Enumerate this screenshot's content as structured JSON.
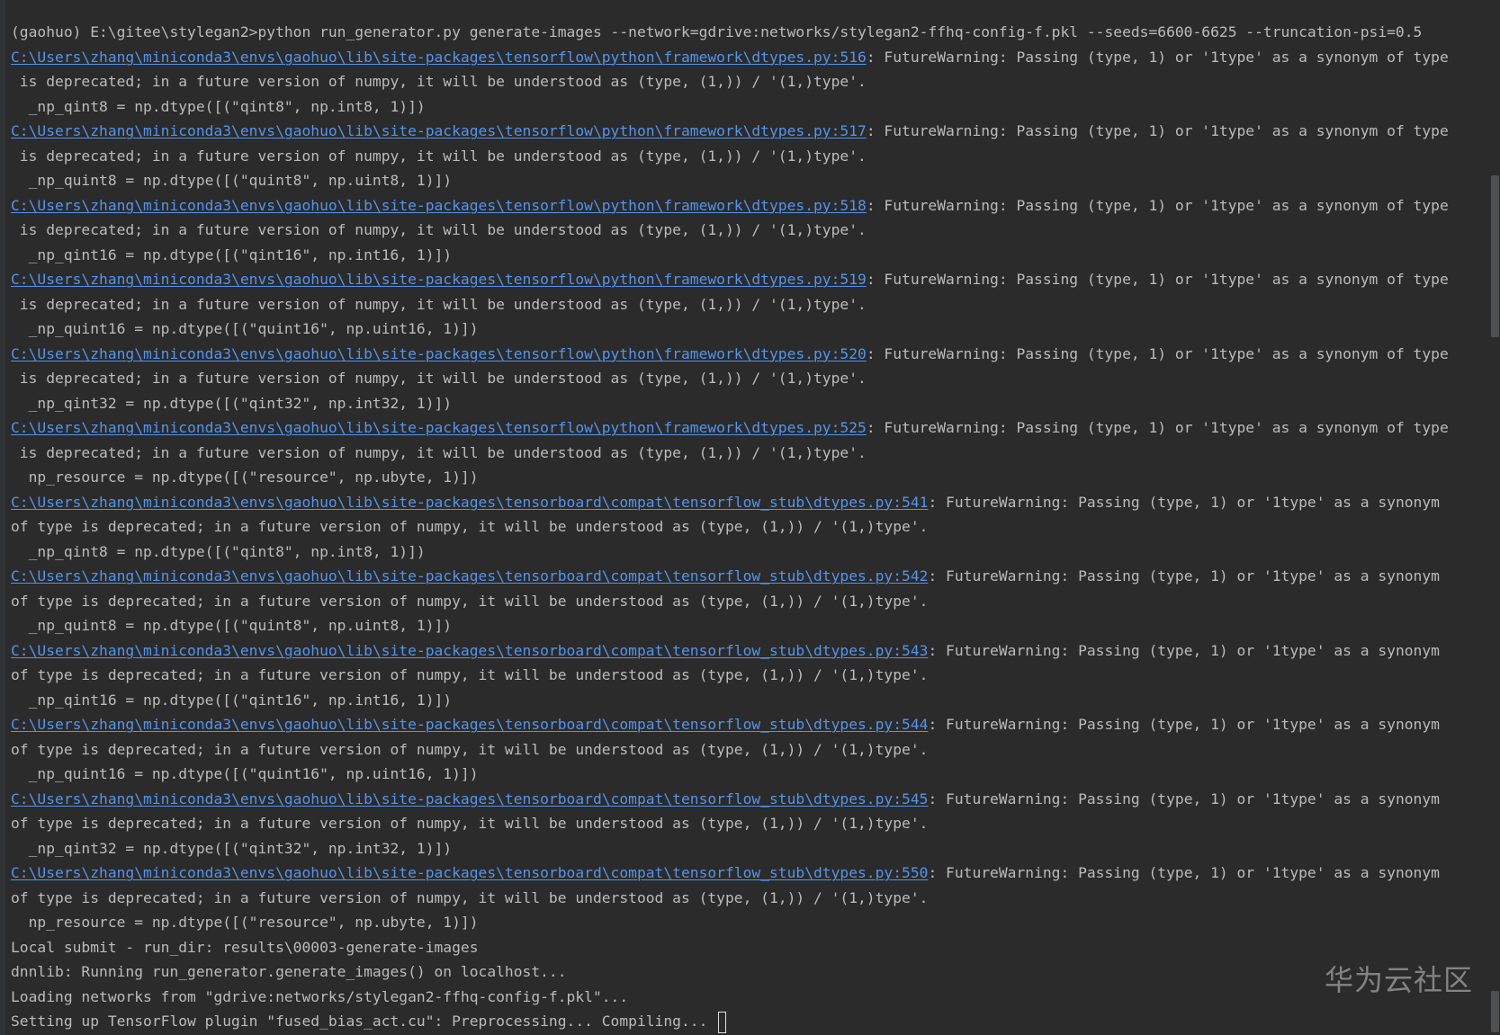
{
  "terminal": {
    "prompt_line": "(gaohuo) E:\\gitee\\stylegan2>python run_generator.py generate-images --network=gdrive:networks/stylegan2-ffhq-config-f.pkl --seeds=6600-6625 --truncation-psi=0.5",
    "warnings": [
      {
        "link": "C:\\Users\\zhang\\miniconda3\\envs\\gaohuo\\lib\\site-packages\\tensorflow\\python\\framework\\dtypes.py:516",
        "msg1": ": FutureWarning: Passing (type, 1) or '1type' as a synonym of type",
        "msg2": " is deprecated; in a future version of numpy, it will be understood as (type, (1,)) / '(1,)type'.",
        "code": "  _np_qint8 = np.dtype([(\"qint8\", np.int8, 1)])"
      },
      {
        "link": "C:\\Users\\zhang\\miniconda3\\envs\\gaohuo\\lib\\site-packages\\tensorflow\\python\\framework\\dtypes.py:517",
        "msg1": ": FutureWarning: Passing (type, 1) or '1type' as a synonym of type",
        "msg2": " is deprecated; in a future version of numpy, it will be understood as (type, (1,)) / '(1,)type'.",
        "code": "  _np_quint8 = np.dtype([(\"quint8\", np.uint8, 1)])"
      },
      {
        "link": "C:\\Users\\zhang\\miniconda3\\envs\\gaohuo\\lib\\site-packages\\tensorflow\\python\\framework\\dtypes.py:518",
        "msg1": ": FutureWarning: Passing (type, 1) or '1type' as a synonym of type",
        "msg2": " is deprecated; in a future version of numpy, it will be understood as (type, (1,)) / '(1,)type'.",
        "code": "  _np_qint16 = np.dtype([(\"qint16\", np.int16, 1)])"
      },
      {
        "link": "C:\\Users\\zhang\\miniconda3\\envs\\gaohuo\\lib\\site-packages\\tensorflow\\python\\framework\\dtypes.py:519",
        "msg1": ": FutureWarning: Passing (type, 1) or '1type' as a synonym of type",
        "msg2": " is deprecated; in a future version of numpy, it will be understood as (type, (1,)) / '(1,)type'.",
        "code": "  _np_quint16 = np.dtype([(\"quint16\", np.uint16, 1)])"
      },
      {
        "link": "C:\\Users\\zhang\\miniconda3\\envs\\gaohuo\\lib\\site-packages\\tensorflow\\python\\framework\\dtypes.py:520",
        "msg1": ": FutureWarning: Passing (type, 1) or '1type' as a synonym of type",
        "msg2": " is deprecated; in a future version of numpy, it will be understood as (type, (1,)) / '(1,)type'.",
        "code": "  _np_qint32 = np.dtype([(\"qint32\", np.int32, 1)])"
      },
      {
        "link": "C:\\Users\\zhang\\miniconda3\\envs\\gaohuo\\lib\\site-packages\\tensorflow\\python\\framework\\dtypes.py:525",
        "msg1": ": FutureWarning: Passing (type, 1) or '1type' as a synonym of type",
        "msg2": " is deprecated; in a future version of numpy, it will be understood as (type, (1,)) / '(1,)type'.",
        "code": "  np_resource = np.dtype([(\"resource\", np.ubyte, 1)])"
      },
      {
        "link": "C:\\Users\\zhang\\miniconda3\\envs\\gaohuo\\lib\\site-packages\\tensorboard\\compat\\tensorflow_stub\\dtypes.py:541",
        "msg1": ": FutureWarning: Passing (type, 1) or '1type' as a synonym",
        "msg2": "of type is deprecated; in a future version of numpy, it will be understood as (type, (1,)) / '(1,)type'.",
        "code": "  _np_qint8 = np.dtype([(\"qint8\", np.int8, 1)])"
      },
      {
        "link": "C:\\Users\\zhang\\miniconda3\\envs\\gaohuo\\lib\\site-packages\\tensorboard\\compat\\tensorflow_stub\\dtypes.py:542",
        "msg1": ": FutureWarning: Passing (type, 1) or '1type' as a synonym",
        "msg2": "of type is deprecated; in a future version of numpy, it will be understood as (type, (1,)) / '(1,)type'.",
        "code": "  _np_quint8 = np.dtype([(\"quint8\", np.uint8, 1)])"
      },
      {
        "link": "C:\\Users\\zhang\\miniconda3\\envs\\gaohuo\\lib\\site-packages\\tensorboard\\compat\\tensorflow_stub\\dtypes.py:543",
        "msg1": ": FutureWarning: Passing (type, 1) or '1type' as a synonym",
        "msg2": "of type is deprecated; in a future version of numpy, it will be understood as (type, (1,)) / '(1,)type'.",
        "code": "  _np_qint16 = np.dtype([(\"qint16\", np.int16, 1)])"
      },
      {
        "link": "C:\\Users\\zhang\\miniconda3\\envs\\gaohuo\\lib\\site-packages\\tensorboard\\compat\\tensorflow_stub\\dtypes.py:544",
        "msg1": ": FutureWarning: Passing (type, 1) or '1type' as a synonym",
        "msg2": "of type is deprecated; in a future version of numpy, it will be understood as (type, (1,)) / '(1,)type'.",
        "code": "  _np_quint16 = np.dtype([(\"quint16\", np.uint16, 1)])"
      },
      {
        "link": "C:\\Users\\zhang\\miniconda3\\envs\\gaohuo\\lib\\site-packages\\tensorboard\\compat\\tensorflow_stub\\dtypes.py:545",
        "msg1": ": FutureWarning: Passing (type, 1) or '1type' as a synonym",
        "msg2": "of type is deprecated; in a future version of numpy, it will be understood as (type, (1,)) / '(1,)type'.",
        "code": "  _np_qint32 = np.dtype([(\"qint32\", np.int32, 1)])"
      },
      {
        "link": "C:\\Users\\zhang\\miniconda3\\envs\\gaohuo\\lib\\site-packages\\tensorboard\\compat\\tensorflow_stub\\dtypes.py:550",
        "msg1": ": FutureWarning: Passing (type, 1) or '1type' as a synonym",
        "msg2": "of type is deprecated; in a future version of numpy, it will be understood as (type, (1,)) / '(1,)type'.",
        "code": "  np_resource = np.dtype([(\"resource\", np.ubyte, 1)])"
      }
    ],
    "status_lines": [
      "Local submit - run_dir: results\\00003-generate-images",
      "dnnlib: Running run_generator.generate_images() on localhost...",
      "Loading networks from \"gdrive:networks/stylegan2-ffhq-config-f.pkl\"...",
      "Setting up TensorFlow plugin \"fused_bias_act.cu\": Preprocessing... Compiling... "
    ]
  },
  "watermark": "华为云社区",
  "colors": {
    "background": "#2b2b2b",
    "text": "#bbbbbb",
    "link": "#5394ec"
  }
}
